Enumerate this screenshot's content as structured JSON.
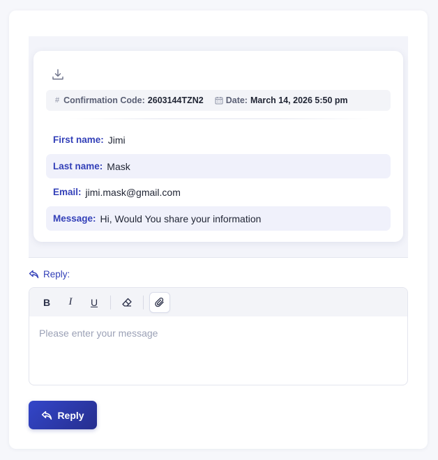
{
  "meta": {
    "hash_symbol": "#",
    "confirmation_label": "Confirmation Code:",
    "confirmation_value": "2603144TZN2",
    "date_label": "Date:",
    "date_value": "March 14, 2026 5:50 pm"
  },
  "fields": [
    {
      "label": "First name:",
      "value": "Jimi"
    },
    {
      "label": "Last name:",
      "value": "Mask"
    },
    {
      "label": "Email:",
      "value": "jimi.mask@gmail.com"
    },
    {
      "label": "Message:",
      "value": "Hi, Would You share your information"
    }
  ],
  "reply": {
    "label": "Reply:",
    "placeholder": "Please enter your message",
    "button_label": "Reply"
  },
  "toolbar": {
    "bold": "B",
    "italic": "I",
    "underline": "U"
  },
  "colors": {
    "accent": "#3340b8",
    "button_start": "#3346c9",
    "button_end": "#262e8e"
  }
}
